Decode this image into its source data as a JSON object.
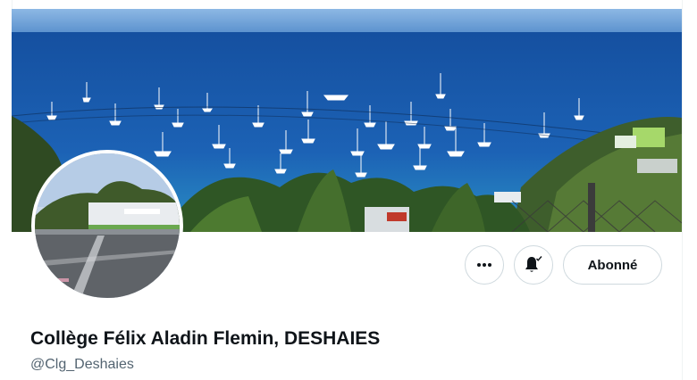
{
  "profile": {
    "display_name": "Collège Félix Aladin Flemin, DESHAIES",
    "handle": "@Clg_Deshaies"
  },
  "actions": {
    "more_icon": "more-horizontal-icon",
    "notify_icon": "bell-check-icon",
    "follow_label": "Abonné"
  },
  "colors": {
    "border": "#cfd9de",
    "text_primary": "#0f1419",
    "text_secondary": "#536471",
    "sea": "#1a5aa8",
    "sky": "#7aaee0"
  }
}
